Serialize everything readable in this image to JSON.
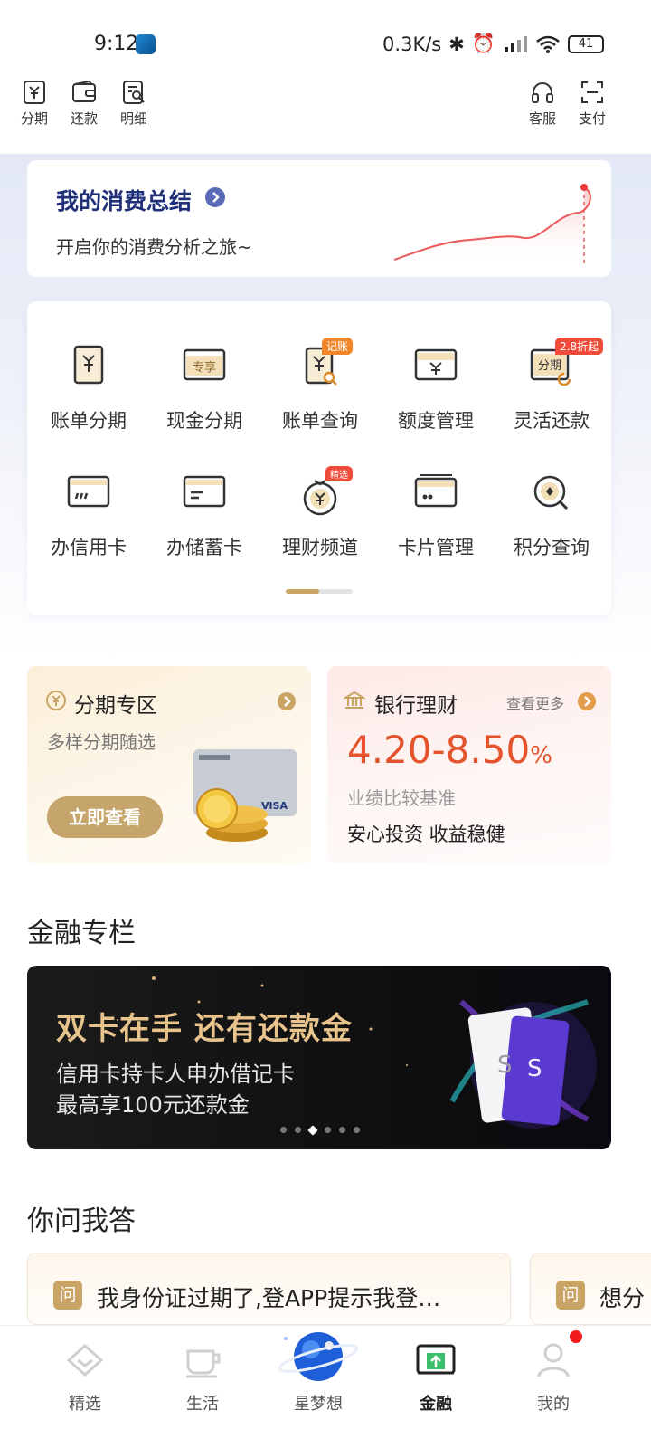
{
  "status_bar": {
    "time": "9:12",
    "net_speed": "0.3K/s",
    "battery": "41"
  },
  "header": {
    "left_items": [
      {
        "label": "分期",
        "icon": "yuan-doc-icon"
      },
      {
        "label": "还款",
        "icon": "wallet-icon"
      },
      {
        "label": "明细",
        "icon": "detail-search-icon"
      }
    ],
    "right_items": [
      {
        "label": "客服",
        "icon": "headset-icon"
      },
      {
        "label": "支付",
        "icon": "scan-icon"
      }
    ]
  },
  "summary": {
    "title": "我的消费总结",
    "subtitle": "开启你的消费分析之旅~"
  },
  "services": [
    {
      "label": "账单分期",
      "icon": "bill-yuan-icon"
    },
    {
      "label": "现金分期",
      "icon": "cash-card-icon",
      "icon_text": "专享"
    },
    {
      "label": "账单查询",
      "icon": "bill-search-icon",
      "tag": "记账"
    },
    {
      "label": "额度管理",
      "icon": "quota-card-icon"
    },
    {
      "label": "灵活还款",
      "icon": "flexible-repay-icon",
      "icon_text": "分期",
      "tag": "2.8折起"
    },
    {
      "label": "办信用卡",
      "icon": "credit-card-icon"
    },
    {
      "label": "办储蓄卡",
      "icon": "debit-card-icon"
    },
    {
      "label": "理财频道",
      "icon": "money-bag-icon",
      "tag": "精选"
    },
    {
      "label": "卡片管理",
      "icon": "card-manage-icon"
    },
    {
      "label": "积分查询",
      "icon": "points-search-icon"
    }
  ],
  "pager": {
    "progress": 0.5
  },
  "promo_installment": {
    "title": "分期专区",
    "subtitle": "多样分期随选",
    "button": "立即查看"
  },
  "promo_wealth": {
    "title": "银行理财",
    "more": "查看更多",
    "rate": "4.20-8.50",
    "rate_unit": "%",
    "benchmark": "业绩比较基准",
    "slogan": "安心投资 收益稳健"
  },
  "finance_column": {
    "title": "金融专栏",
    "banner": {
      "title": "双卡在手 还有还款金",
      "line1": "信用卡持卡人申办借记卡",
      "line2": "最高享100元还款金",
      "dots": 6,
      "active_dot": 2
    }
  },
  "qa": {
    "title": "你问我答",
    "badge": "问",
    "items": [
      "我身份证过期了,登APP提示我登…",
      "想分"
    ]
  },
  "bottom_nav": [
    {
      "label": "精选",
      "icon": "diamond-icon"
    },
    {
      "label": "生活",
      "icon": "cup-icon"
    },
    {
      "label": "星梦想",
      "icon": "planet-icon"
    },
    {
      "label": "金融",
      "icon": "finance-card-icon",
      "active": true
    },
    {
      "label": "我的",
      "icon": "user-icon",
      "badge": true
    }
  ],
  "colors": {
    "gold": "#c9a465",
    "navy": "#1f2f78",
    "red": "#e5532d",
    "badge_red": "#f21a1a"
  }
}
